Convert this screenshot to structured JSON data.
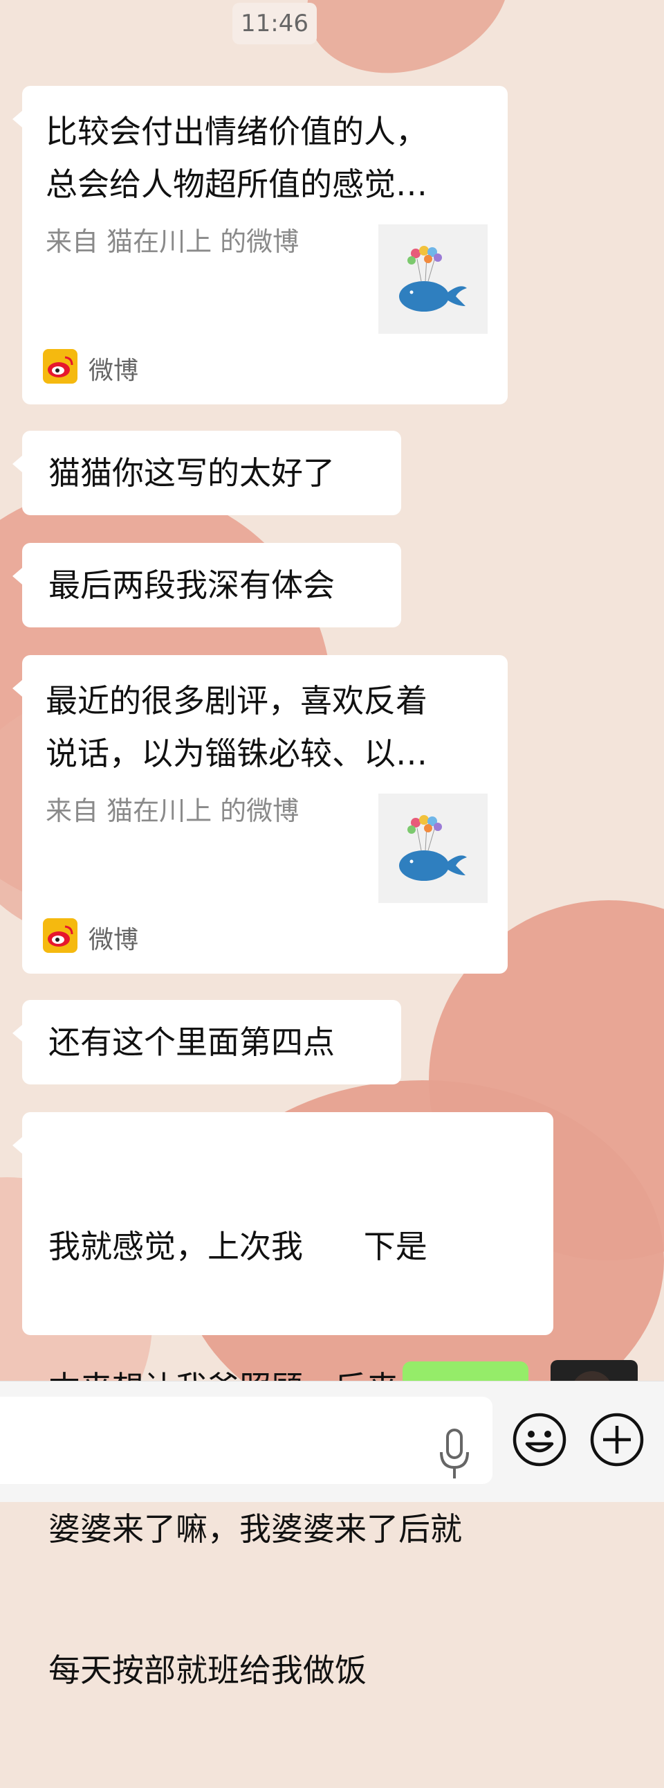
{
  "status_time": "11:46",
  "messages": [
    {
      "kind": "card",
      "title_line1": "比较会付出情绪价值的人，",
      "title_line2": "总会给人物超所值的感觉…",
      "source": "来自 猫在川上 的微博",
      "app": "微博"
    },
    {
      "kind": "text",
      "text": "猫猫你这写的太好了"
    },
    {
      "kind": "text",
      "text": "最后两段我深有体会"
    },
    {
      "kind": "card",
      "title_line1": "最近的很多剧评，喜欢反着",
      "title_line2": "说话，以为锱铢必较、以…",
      "source": "来自 猫在川上 的微博",
      "app": "微博"
    },
    {
      "kind": "text",
      "text": "还有这个里面第四点"
    },
    {
      "kind": "text",
      "lines": [
        "我就感觉，上次我      下是",
        "本来想让我爸照顾，后来让我",
        "婆婆来了嘛，我婆婆来了后就",
        "每天按部就班给我做饭"
      ]
    }
  ],
  "input": {
    "value": "",
    "placeholder": ""
  },
  "icons": {
    "voice": "microphone-icon",
    "emoji": "emoji-icon",
    "more": "plus-icon"
  },
  "colors": {
    "bubble": "#ffffff",
    "self_bubble": "#95ec69",
    "bar": "#f5f5f5",
    "weibo_red": "#e6162d",
    "weibo_yellow": "#f5b90f"
  }
}
